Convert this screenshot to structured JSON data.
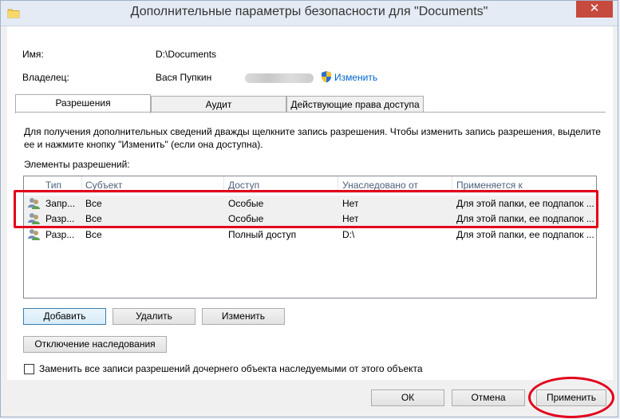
{
  "window": {
    "title": "Дополнительные параметры безопасности  для \"Documents\"",
    "close_glyph": "✕"
  },
  "info": {
    "name_label": "Имя:",
    "name_value": "D:\\Documents",
    "owner_label": "Владелец:",
    "owner_value": "Вася Пупкин",
    "change_link": "Изменить"
  },
  "tabs": [
    {
      "label": "Разрешения",
      "active": true
    },
    {
      "label": "Аудит",
      "active": false
    },
    {
      "label": "Действующие права доступа",
      "active": false
    }
  ],
  "instructions": "Для получения дополнительных сведений дважды щелкните запись разрешения. Чтобы изменить запись разрешения, выделите ее и нажмите кнопку \"Изменить\" (если она доступна).",
  "entries_label": "Элементы разрешений:",
  "table": {
    "columns": [
      "Тип",
      "Субъект",
      "Доступ",
      "Унаследовано от",
      "Применяется к"
    ],
    "rows": [
      {
        "type": "Запр...",
        "subject": "Все",
        "access": "Особые",
        "inherited": "Нет",
        "applies": "Для этой папки, ее подпапок ..."
      },
      {
        "type": "Разр...",
        "subject": "Все",
        "access": "Особые",
        "inherited": "Нет",
        "applies": "Для этой папки, ее подпапок ..."
      },
      {
        "type": "Разр...",
        "subject": "Все",
        "access": "Полный доступ",
        "inherited": "D:\\",
        "applies": "Для этой папки, ее подпапок ..."
      }
    ]
  },
  "buttons": {
    "add": "Добавить",
    "remove": "Удалить",
    "edit": "Изменить",
    "disable_inheritance": "Отключение наследования",
    "ok": "ОК",
    "cancel": "Отмена",
    "apply": "Применить"
  },
  "replace_checkbox": {
    "label": "Заменить все записи разрешений дочернего объекта наследуемыми от этого объекта",
    "checked": false
  }
}
